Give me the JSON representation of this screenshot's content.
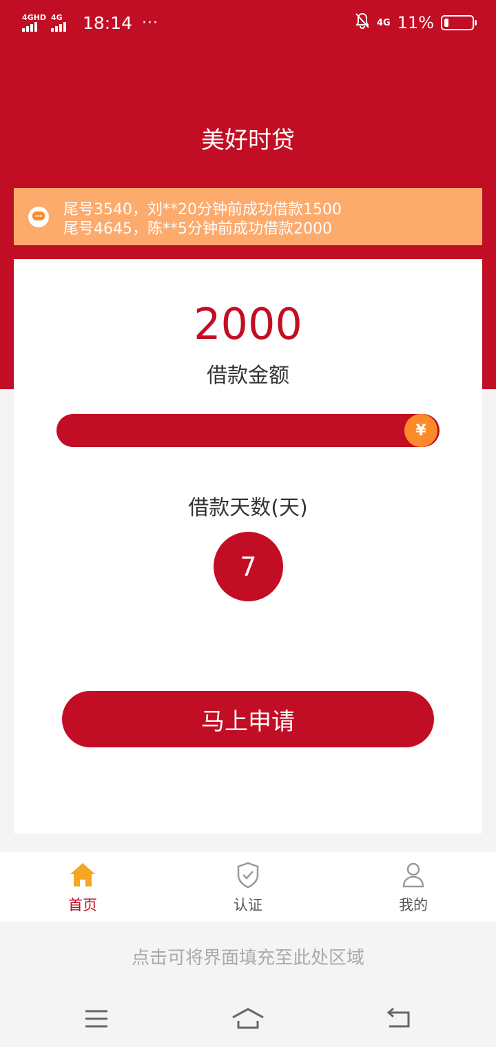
{
  "status_bar": {
    "sim1": "4GHD",
    "sim2": "4G",
    "time": "18:14",
    "more": "···",
    "network": "4G",
    "battery": "11%"
  },
  "app_title": "美好时贷",
  "notice": {
    "lines": [
      "尾号3540，刘**20分钟前成功借款1500",
      "尾号4645，陈**5分钟前成功借款2000"
    ]
  },
  "loan": {
    "amount": "2000",
    "amount_label": "借款金额",
    "slider_thumb_symbol": "¥",
    "slider_level": 1.0,
    "days_label": "借款天数(天)",
    "days_value": "7",
    "apply_label": "马上申请"
  },
  "tabs": [
    {
      "label": "首页",
      "icon": "home-icon",
      "active": true
    },
    {
      "label": "认证",
      "icon": "shield-check-icon",
      "active": false
    },
    {
      "label": "我的",
      "icon": "user-icon",
      "active": false
    }
  ],
  "fill_hint": "点击可将界面填充至此处区域",
  "colors": {
    "primary": "#c20e24",
    "notice_bg": "#fdaa6d",
    "thumb": "#fc8a2a",
    "active_icon": "#f5a623"
  }
}
